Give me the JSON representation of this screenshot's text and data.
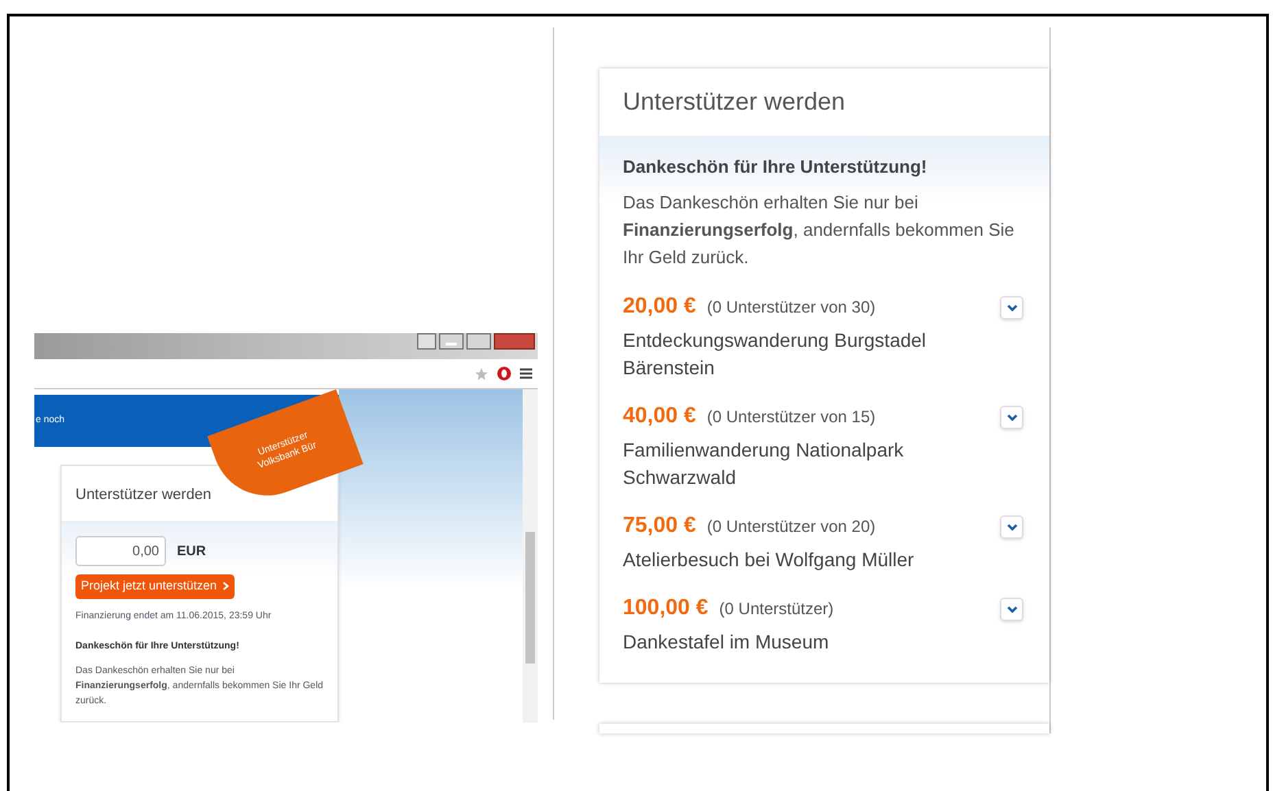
{
  "left_screenshot": {
    "header_tagline": "e noch",
    "ribbon_lines": [
      "Unterstützer",
      "Volksbank Bür"
    ],
    "card": {
      "title": "Unterstützer werden",
      "amount": "0,00",
      "currency": "EUR",
      "button": "Projekt jetzt unterstützen",
      "deadline": "Finanzierung endet am 11.06.2015, 23:59 Uhr",
      "thanks_title": "Dankeschön für Ihre Unterstützung!",
      "thanks_text": "Das Dankeschön erhalten Sie nur bei **Finanzierungserfolg**, andernfalls bekommen Sie Ihr Geld zurück."
    }
  },
  "right_panel": {
    "title": "Unterstützer werden",
    "thanks_title": "Dankeschön für Ihre Unterstützung!",
    "thanks_text": "Das Dankeschön erhalten Sie nur bei **Finanzierungserfolg**, andernfalls bekommen Sie Ihr Geld zurück.",
    "rewards": [
      {
        "price": "20,00 €",
        "supporters": "(0 Unterstützer von 30)",
        "name": "Entdeckungswanderung Burgstadel Bärenstein",
        "expanded": false
      },
      {
        "price": "40,00 €",
        "supporters": "(0 Unterstützer von 15)",
        "name": "Familienwanderung Nationalpark Schwarzwald",
        "expanded": false
      },
      {
        "price": "75,00 €",
        "supporters": "(0 Unterstützer von 20)",
        "name": "Atelierbesuch bei Wolfgang Müller",
        "expanded": false
      },
      {
        "price": "100,00 €",
        "supporters": "(0 Unterstützer)",
        "name": "Dankestafel im Museum",
        "expanded": false
      }
    ]
  }
}
